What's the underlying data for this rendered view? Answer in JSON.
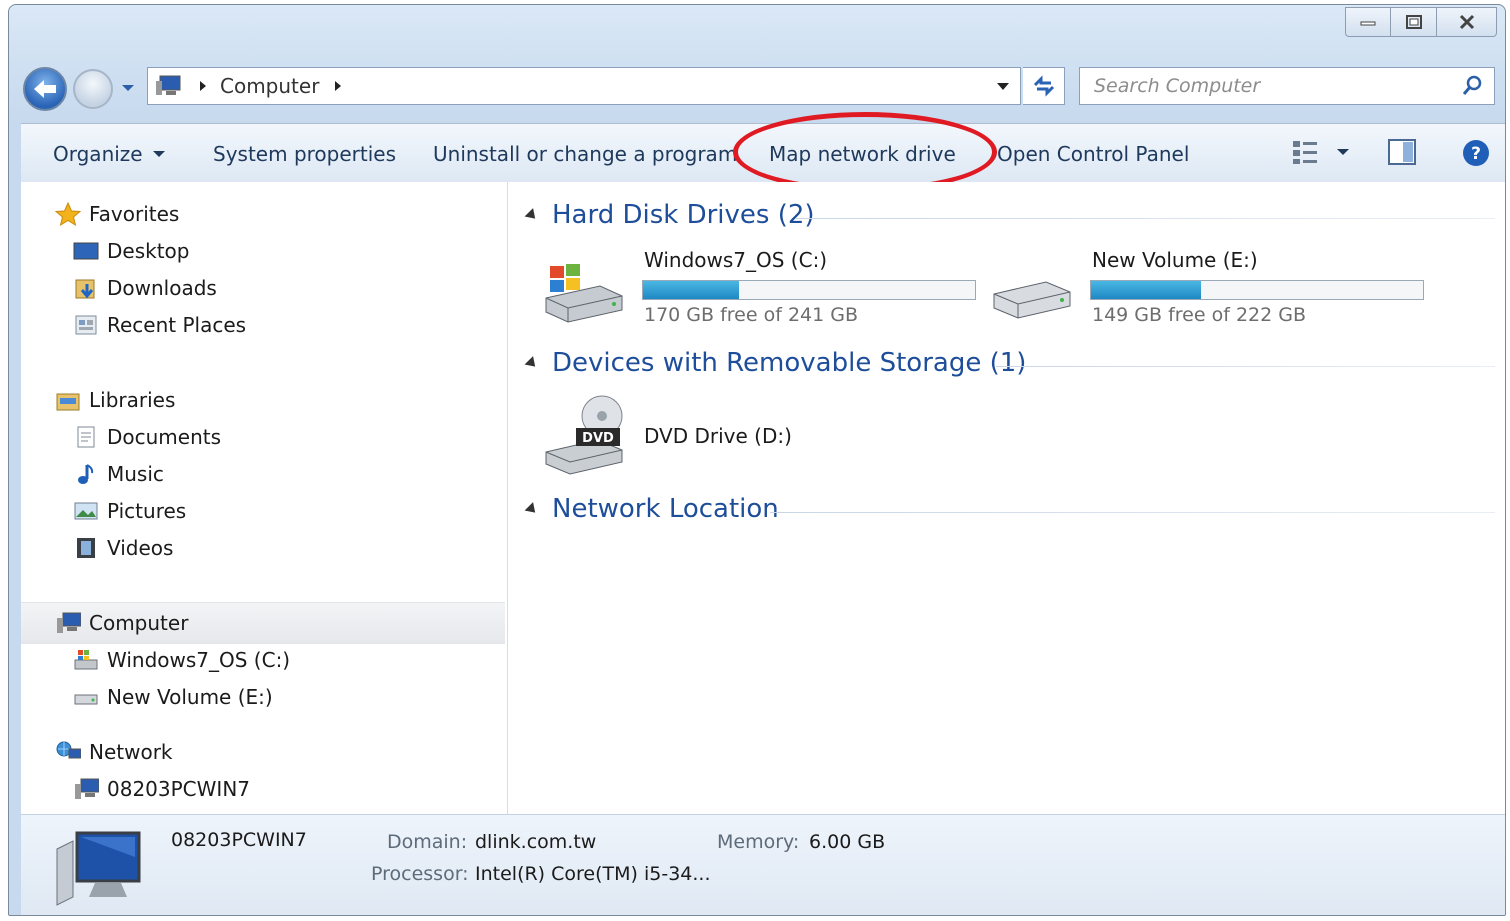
{
  "address": {
    "path_label": "Computer",
    "search_placeholder": "Search Computer"
  },
  "toolbar": {
    "organize": "Organize",
    "system_properties": "System properties",
    "uninstall": "Uninstall or change a program",
    "map_network_drive": "Map network drive",
    "open_control_panel": "Open Control Panel",
    "highlight_color": "#e01a22"
  },
  "nav": {
    "favorites": "Favorites",
    "desktop": "Desktop",
    "downloads": "Downloads",
    "recent_places": "Recent Places",
    "libraries": "Libraries",
    "documents": "Documents",
    "music": "Music",
    "pictures": "Pictures",
    "videos": "Videos",
    "computer": "Computer",
    "drive_c": "Windows7_OS (C:)",
    "drive_e": "New Volume (E:)",
    "network": "Network",
    "network_pc": "08203PCWIN7"
  },
  "content": {
    "hdd_header": "Hard Disk Drives (2)",
    "removable_header": "Devices with Removable Storage (1)",
    "network_header": "Network Location",
    "drives": [
      {
        "name": "Windows7_OS (C:)",
        "free_text": "170 GB free of 241 GB",
        "used_fraction": 0.29,
        "icon": "windows-drive-icon"
      },
      {
        "name": "New Volume (E:)",
        "free_text": "149 GB free of 222 GB",
        "used_fraction": 0.33,
        "icon": "hard-drive-icon"
      }
    ],
    "dvd": {
      "name": "DVD Drive (D:)",
      "icon_text": "DVD"
    }
  },
  "details": {
    "computer_name": "08203PCWIN7",
    "domain_label": "Domain:",
    "domain_value": "dlink.com.tw",
    "memory_label": "Memory:",
    "memory_value": "6.00 GB",
    "processor_label": "Processor:",
    "processor_value": "Intel(R) Core(TM) i5-34..."
  },
  "colors": {
    "header_blue": "#1e4e9a",
    "bar_fill": "#2196d3"
  }
}
